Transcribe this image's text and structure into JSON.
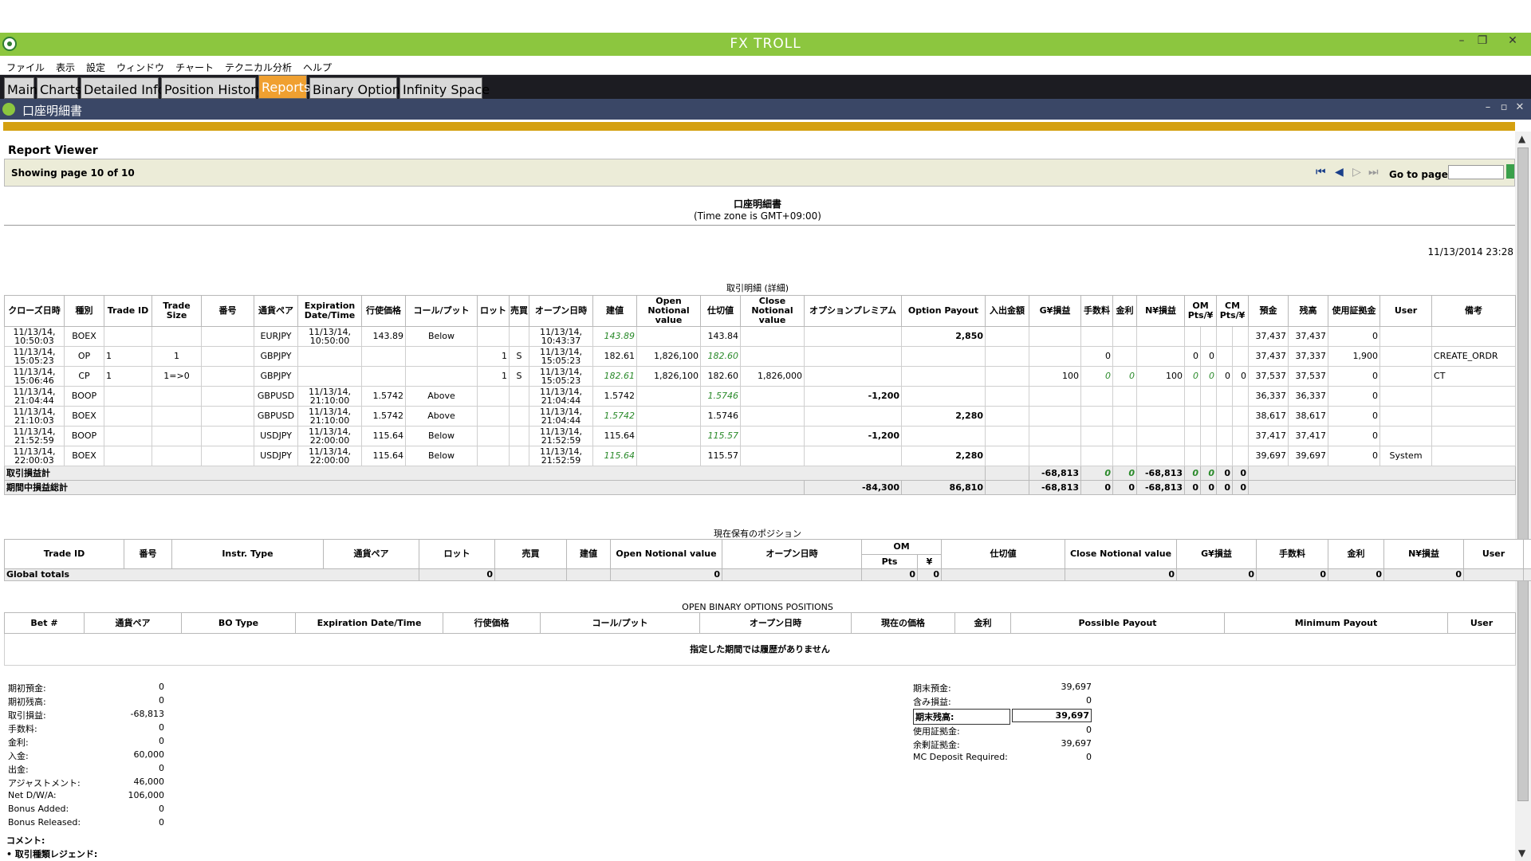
{
  "app": {
    "title": "FX TROLL"
  },
  "menu": [
    "ファイル",
    "表示",
    "設定",
    "ウィンドウ",
    "チャート",
    "テクニカル分析",
    "ヘルプ"
  ],
  "tabs": [
    "Main",
    "Charts",
    "Detailed Info",
    "Position History",
    "Reports",
    "Binary Options",
    "Infinity Space"
  ],
  "active_tab": "Reports",
  "window": {
    "title": "口座明細書"
  },
  "viewer": {
    "title": "Report Viewer",
    "page_info": "Showing page 10 of 10",
    "goto_label": "Go to page:",
    "goto_value": ""
  },
  "report": {
    "title": "口座明細書",
    "timezone": "(Time zone is GMT+09:00)",
    "timestamp": "11/13/2014 23:28"
  },
  "trades": {
    "section_title": "取引明細 (詳細)",
    "headers": [
      "クローズ日時",
      "種別",
      "Trade ID",
      "Trade Size",
      "番号",
      "通貨ペア",
      "Expiration Date/Time",
      "行使価格",
      "コール/プット",
      "ロット",
      "売買",
      "オープン日時",
      "建値",
      "Open Notional value",
      "仕切値",
      "Close Notional value",
      "オプションプレミアム",
      "Option Payout",
      "入出金額",
      "G¥損益",
      "手数料",
      "金利",
      "N¥損益",
      "OM Pts/¥",
      "",
      "CM Pts/¥",
      "",
      "預金",
      "残高",
      "使用証拠金",
      "User",
      "備考"
    ],
    "rows": [
      [
        "11/13/14, 10:50:03",
        "BOEX",
        "",
        "",
        "",
        "EURJPY",
        "11/13/14, 10:50:00",
        "143.89",
        "Below",
        "",
        "",
        "11/13/14, 10:43:37",
        "143.89",
        "",
        "143.84",
        "",
        "",
        "2,850",
        "",
        "",
        "",
        "",
        "",
        "",
        "",
        "",
        "",
        "37,437",
        "37,437",
        "0",
        "",
        ""
      ],
      [
        "11/13/14, 15:05:23",
        "OP",
        "1",
        "1",
        "",
        "GBPJPY",
        "",
        "",
        "",
        "1",
        "S",
        "11/13/14, 15:05:23",
        "182.61",
        "1,826,100",
        "182.60",
        "",
        "",
        "",
        "",
        "",
        "0",
        "",
        "",
        "0",
        "0",
        "",
        "",
        "37,437",
        "37,337",
        "1,900",
        "",
        "CREATE_ORDR"
      ],
      [
        "11/13/14, 15:06:46",
        "CP",
        "1",
        "1=>0",
        "",
        "GBPJPY",
        "",
        "",
        "",
        "1",
        "S",
        "11/13/14, 15:05:23",
        "182.61",
        "1,826,100",
        "182.60",
        "1,826,000",
        "",
        "",
        "",
        "100",
        "0",
        "0",
        "100",
        "0",
        "0",
        "0",
        "0",
        "37,537",
        "37,537",
        "0",
        "",
        "CT"
      ],
      [
        "11/13/14, 21:04:44",
        "BOOP",
        "",
        "",
        "",
        "GBPUSD",
        "11/13/14, 21:10:00",
        "1.5742",
        "Above",
        "",
        "",
        "11/13/14, 21:04:44",
        "1.5742",
        "",
        "1.5746",
        "",
        "-1,200",
        "",
        "",
        "",
        "",
        "",
        "",
        "",
        "",
        "",
        "",
        "36,337",
        "36,337",
        "0",
        "",
        ""
      ],
      [
        "11/13/14, 21:10:03",
        "BOEX",
        "",
        "",
        "",
        "GBPUSD",
        "11/13/14, 21:10:00",
        "1.5742",
        "Above",
        "",
        "",
        "11/13/14, 21:04:44",
        "1.5742",
        "",
        "1.5746",
        "",
        "",
        "2,280",
        "",
        "",
        "",
        "",
        "",
        "",
        "",
        "",
        "",
        "38,617",
        "38,617",
        "0",
        "",
        ""
      ],
      [
        "11/13/14, 21:52:59",
        "BOOP",
        "",
        "",
        "",
        "USDJPY",
        "11/13/14, 22:00:00",
        "115.64",
        "Below",
        "",
        "",
        "11/13/14, 21:52:59",
        "115.64",
        "",
        "115.57",
        "",
        "-1,200",
        "",
        "",
        "",
        "",
        "",
        "",
        "",
        "",
        "",
        "",
        "37,417",
        "37,417",
        "0",
        "",
        ""
      ],
      [
        "11/13/14, 22:00:03",
        "BOEX",
        "",
        "",
        "",
        "USDJPY",
        "11/13/14, 22:00:00",
        "115.64",
        "Below",
        "",
        "",
        "11/13/14, 21:52:59",
        "115.64",
        "",
        "115.57",
        "",
        "",
        "2,280",
        "",
        "",
        "",
        "",
        "",
        "",
        "",
        "",
        "",
        "39,697",
        "39,697",
        "0",
        "System",
        ""
      ]
    ],
    "totals_label": "取引損益計",
    "totals": {
      "gy": "-68,813",
      "fee": "0",
      "int": "0",
      "ny": "-68,813",
      "om1": "0",
      "om2": "0",
      "cm1": "0",
      "cm2": "0"
    },
    "period_label": "期間中損益総計",
    "period": {
      "premium": "-84,300",
      "payout": "86,810",
      "gy": "-68,813",
      "fee": "0",
      "int": "0",
      "ny": "-68,813",
      "om1": "0",
      "om2": "0",
      "cm1": "0",
      "cm2": "0"
    }
  },
  "positions": {
    "section_title": "現在保有のポジション",
    "headers": [
      "Trade ID",
      "番号",
      "Instr. Type",
      "通貨ペア",
      "ロット",
      "売買",
      "建値",
      "Open Notional value",
      "オープン日時",
      "OM",
      "Pts",
      "¥",
      "仕切値",
      "Close Notional value",
      "G¥損益",
      "手数料",
      "金利",
      "N¥損益",
      "User",
      "備考"
    ],
    "totals_label": "Global totals",
    "totals": {
      "lot": "0",
      "open_notional": "0",
      "pts": "0",
      "yen": "0",
      "close_notional": "0",
      "gy": "0",
      "fee": "0",
      "int": "0",
      "ny": "0"
    }
  },
  "binary": {
    "section_title": "OPEN BINARY OPTIONS POSITIONS",
    "headers": [
      "Bet #",
      "通貨ペア",
      "BO Type",
      "Expiration Date/Time",
      "行使価格",
      "コール/プット",
      "オープン日時",
      "現在の価格",
      "金利",
      "Possible Payout",
      "Minimum Payout",
      "User"
    ],
    "empty": "指定した期間では履歴がありません"
  },
  "summary_left": [
    [
      "期初預金:",
      "0"
    ],
    [
      "期初残高:",
      "0"
    ],
    [
      "取引損益:",
      "-68,813"
    ],
    [
      "手数料:",
      "0"
    ],
    [
      "金利:",
      "0"
    ],
    [
      "入金:",
      "60,000"
    ],
    [
      "出金:",
      "0"
    ],
    [
      "アジャストメント:",
      "46,000"
    ],
    [
      "Net D/W/A:",
      "106,000"
    ],
    [
      "Bonus Added:",
      "0"
    ],
    [
      "Bonus Released:",
      "0"
    ]
  ],
  "summary_right": [
    [
      "期末預金:",
      "39,697"
    ],
    [
      "含み損益:",
      "0"
    ],
    [
      "期末残高:",
      "39,697"
    ],
    [
      "使用証拠金:",
      "0"
    ],
    [
      "余剰証拠金:",
      "39,697"
    ],
    [
      "MC Deposit Required:",
      "0"
    ]
  ],
  "comment_label": "コメント:",
  "legend_label": "取引種類レジェンド:",
  "colors": {
    "titlebar": "#8cc63f",
    "active_tab": "#f0a030",
    "subbar": "#3a4766",
    "gold": "#d4a010",
    "positive_green": "#2a8a2a"
  }
}
